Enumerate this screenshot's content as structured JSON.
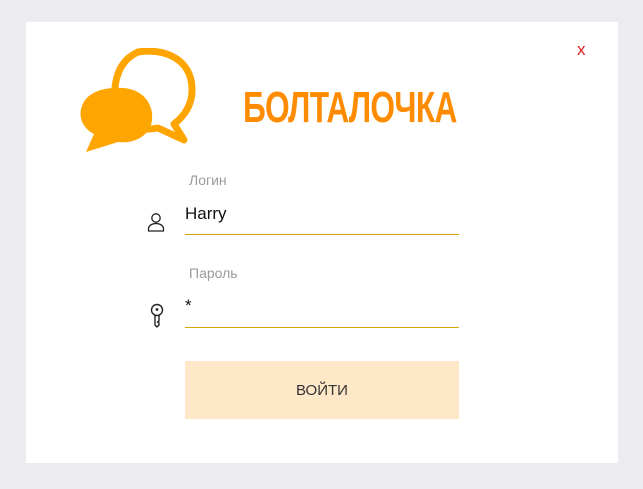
{
  "window": {
    "close_label": "x",
    "brand_title": "БОЛТАЛОЧКА"
  },
  "login": {
    "label": "Логин",
    "value": "Harry",
    "icon": "user-icon"
  },
  "password": {
    "label": "Пароль",
    "value": "*",
    "icon": "key-icon"
  },
  "submit": {
    "label": "ВОЙТИ"
  },
  "colors": {
    "accent": "#ff8c00",
    "bubble": "#ffa500",
    "underline": "#d9a400",
    "button_bg": "#ffe8c8",
    "close": "#e11d1d",
    "backdrop": "#ebebf0"
  }
}
